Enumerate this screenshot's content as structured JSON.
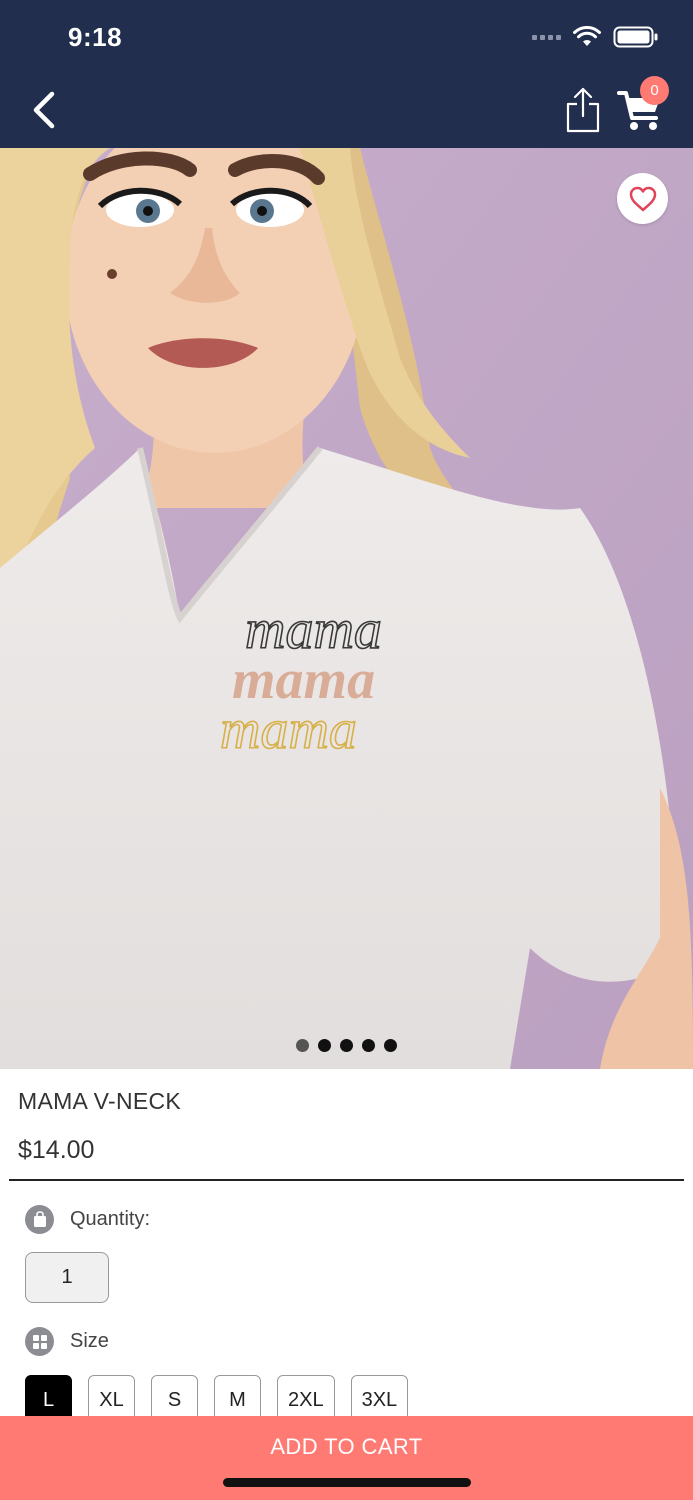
{
  "status_bar": {
    "time": "9:18"
  },
  "header": {
    "cart_count": "0"
  },
  "product": {
    "image_text": [
      "mama",
      "mama",
      "mama"
    ],
    "carousel": {
      "total": 5,
      "active_index": 0
    },
    "name": "MAMA V-NECK",
    "price": "$14.00"
  },
  "options": {
    "quantity_label": "Quantity:",
    "quantity_value": "1",
    "size_label": "Size",
    "sizes": [
      "L",
      "XL",
      "S",
      "M",
      "2XL",
      "3XL"
    ],
    "selected_size": "L"
  },
  "actions": {
    "add_to_cart": "ADD TO CART"
  },
  "colors": {
    "header_bg": "#222e4e",
    "accent": "#ff7a73",
    "favorite_heart": "#e0445a",
    "backdrop": "#c4a9c9"
  },
  "icons": [
    "back-chevron-icon",
    "share-icon",
    "cart-icon",
    "heart-icon",
    "bag-icon",
    "grid-icon",
    "wifi-icon",
    "battery-icon"
  ]
}
